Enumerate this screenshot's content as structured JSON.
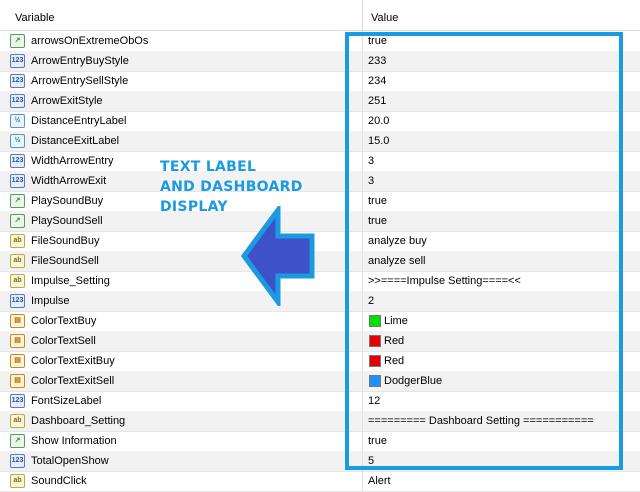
{
  "header": {
    "variable_label": "Variable",
    "value_label": "Value"
  },
  "rows": [
    {
      "name": "arrowsOnExtremeObOs",
      "value": "true",
      "type": "bool"
    },
    {
      "name": "ArrowEntryBuyStyle",
      "value": "233",
      "type": "int"
    },
    {
      "name": "ArrowEntrySellStyle",
      "value": "234",
      "type": "int"
    },
    {
      "name": "ArrowExitStyle",
      "value": "251",
      "type": "int"
    },
    {
      "name": "DistanceEntryLabel",
      "value": "20.0",
      "type": "double"
    },
    {
      "name": "DistanceExitLabel",
      "value": "15.0",
      "type": "double"
    },
    {
      "name": "WidthArrowEntry",
      "value": "3",
      "type": "int"
    },
    {
      "name": "WidthArrowExit",
      "value": "3",
      "type": "int"
    },
    {
      "name": "PlaySoundBuy",
      "value": "true",
      "type": "bool"
    },
    {
      "name": "PlaySoundSell",
      "value": "true",
      "type": "bool"
    },
    {
      "name": "FileSoundBuy",
      "value": "analyze buy",
      "type": "string"
    },
    {
      "name": "FileSoundSell",
      "value": "analyze sell",
      "type": "string"
    },
    {
      "name": "Impulse_Setting",
      "value": ">>====Impulse Setting====<<",
      "type": "string"
    },
    {
      "name": "Impulse",
      "value": "2",
      "type": "int"
    },
    {
      "name": "ColorTextBuy",
      "value": "Lime",
      "type": "color",
      "swatch": "#00e000"
    },
    {
      "name": "ColorTextSell",
      "value": "Red",
      "type": "color",
      "swatch": "#e60000"
    },
    {
      "name": "ColorTextExitBuy",
      "value": "Red",
      "type": "color",
      "swatch": "#e60000"
    },
    {
      "name": "ColorTextExitSell",
      "value": "DodgerBlue",
      "type": "color",
      "swatch": "#1e90ff"
    },
    {
      "name": "FontSizeLabel",
      "value": "12",
      "type": "int"
    },
    {
      "name": "Dashboard_Setting",
      "value": "========= Dashboard Setting ===========",
      "type": "string"
    },
    {
      "name": "Show Information",
      "value": "true",
      "type": "bool"
    },
    {
      "name": "TotalOpenShow",
      "value": "5",
      "type": "int"
    },
    {
      "name": "SoundClick",
      "value": "Alert",
      "type": "string"
    }
  ],
  "annotation": {
    "line1": "TEXT LABEL",
    "line2": "AND DASHBOARD",
    "line3": "DISPLAY"
  },
  "colors": {
    "highlight": "#1a9ae0",
    "arrow_fill": "#3f51c9",
    "arrow_outline": "#1a9ae0"
  },
  "icon_names": {
    "bool": "boolean-green-arrow-icon",
    "int": "integer-123-icon",
    "double": "double-half-icon",
    "string": "string-ab-icon",
    "color": "color-palette-icon"
  }
}
